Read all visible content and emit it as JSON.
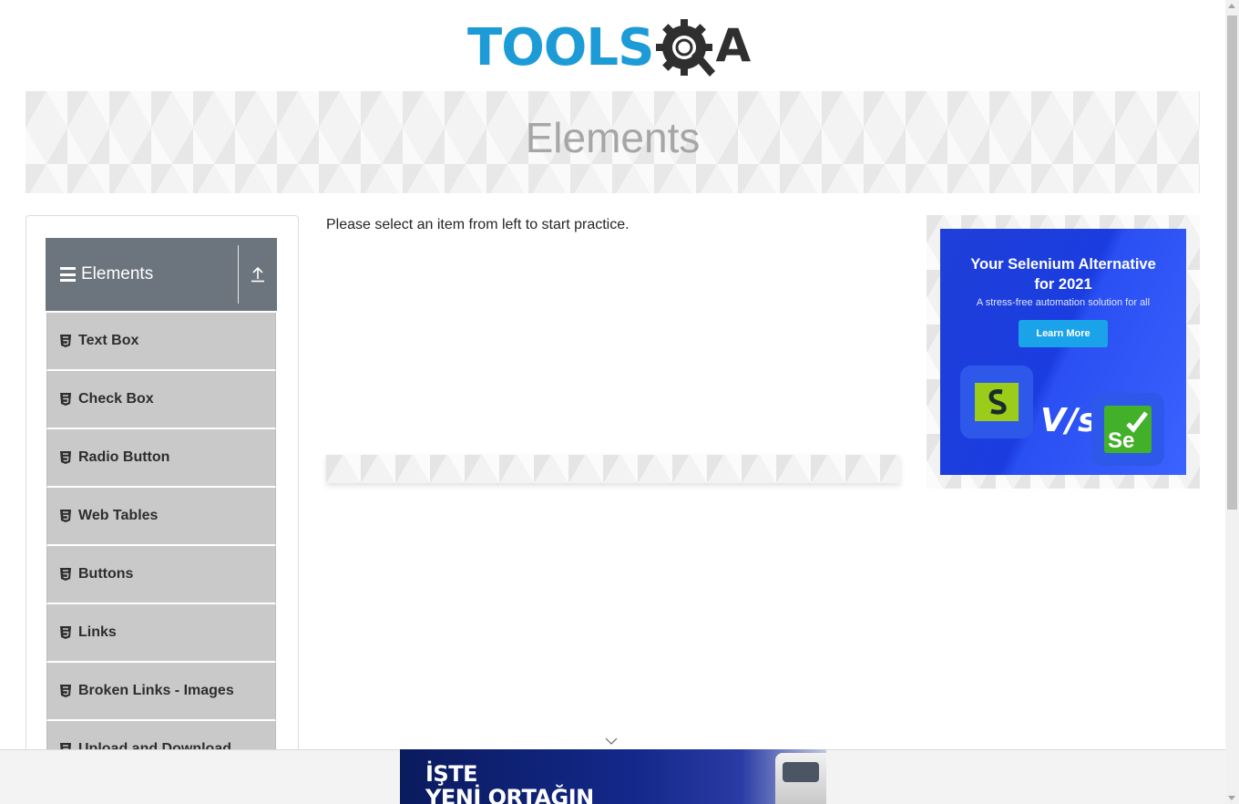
{
  "header": {
    "logo_tools": "TOOLS",
    "logo_a": "A"
  },
  "banner": {
    "title": "Elements"
  },
  "sidebar": {
    "group_label": "Elements",
    "items": [
      {
        "label": "Text Box"
      },
      {
        "label": "Check Box"
      },
      {
        "label": "Radio Button"
      },
      {
        "label": "Web Tables"
      },
      {
        "label": "Buttons"
      },
      {
        "label": "Links"
      },
      {
        "label": "Broken Links - Images"
      },
      {
        "label": "Upload and Download"
      }
    ]
  },
  "main": {
    "message": "Please select an item from left to start practice."
  },
  "side_ad": {
    "title_line1": "Your Selenium Alternative",
    "title_line2": "for 2021",
    "subtitle": "A stress-free automation solution for all",
    "button": "Learn More",
    "vs": "V/s",
    "se": "Se"
  },
  "bottom_ad": {
    "line1": "İŞTE",
    "line2": "YENİ ORTAĞIN"
  },
  "colors": {
    "brand_blue": "#1d9bd7",
    "sidebar_header": "#6c757d",
    "menu_item_bg": "#c9c9c9",
    "ad_blue": "#1f3fd8"
  }
}
